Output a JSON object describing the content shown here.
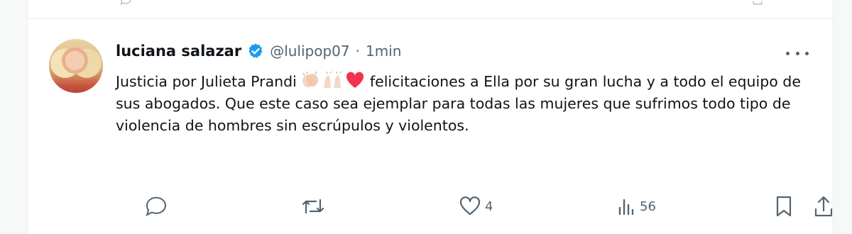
{
  "tweet": {
    "author_name": "luciana salazar",
    "handle": "@lulipop07",
    "separator": "·",
    "time": "1min",
    "text_part1": "Justicia por Julieta Prandi ",
    "text_part2": " felicitaciones a Ella por su gran lucha y a todo el equipo de sus abogados. Que este caso sea ejemplar para todas las mujeres que sufrimos todo tipo de violencia de hombres sin escrúpulos y violentos.",
    "emojis": [
      "clapping-hands-icon",
      "raising-hands-icon",
      "red-heart-icon"
    ]
  },
  "actions": {
    "reply_count": "",
    "retweet_count": "",
    "like_count": "4",
    "views_count": "56"
  },
  "icons": [
    "verified-badge-icon",
    "more-options-icon",
    "reply-icon",
    "retweet-icon",
    "like-icon",
    "views-icon",
    "bookmark-icon",
    "share-icon"
  ],
  "colors": {
    "verified": "#1d9bf0",
    "heart": "#f0324c",
    "muted": "#536471"
  }
}
